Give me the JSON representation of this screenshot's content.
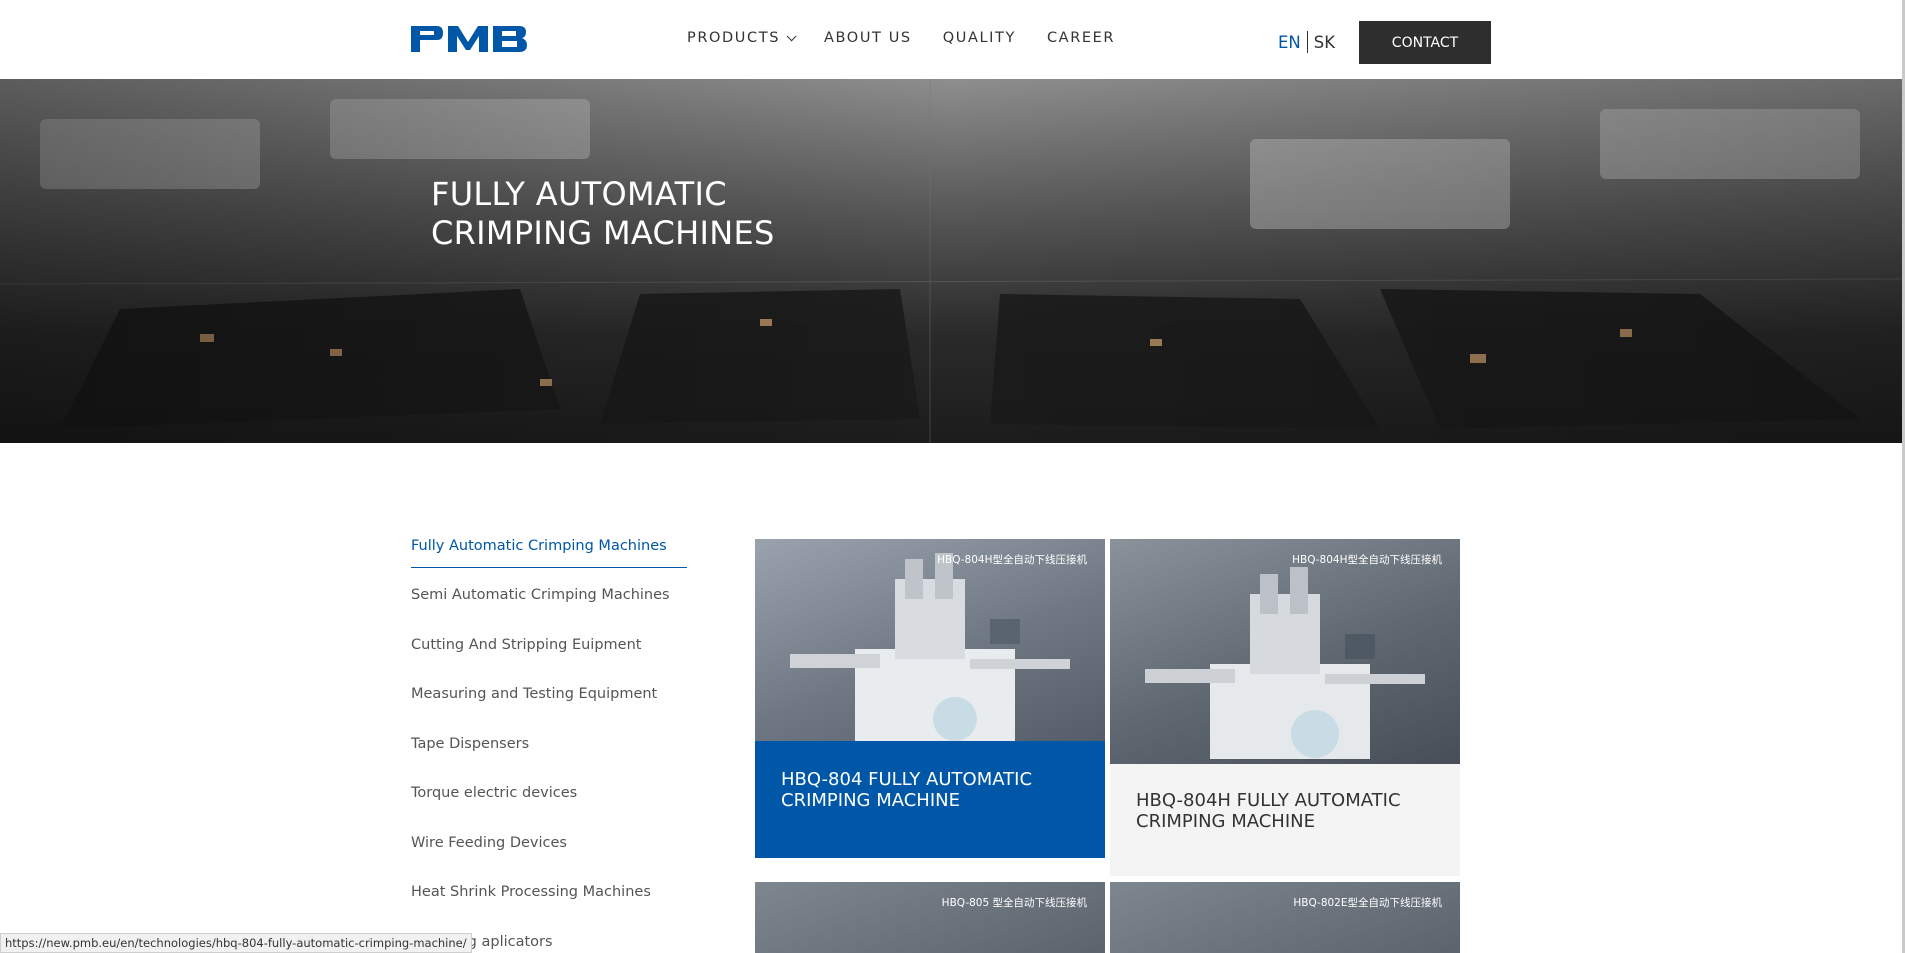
{
  "header": {
    "logo_text": "PMB",
    "nav": [
      {
        "label": "PRODUCTS",
        "has_dropdown": true
      },
      {
        "label": "ABOUT US"
      },
      {
        "label": "QUALITY"
      },
      {
        "label": "CAREER"
      }
    ],
    "lang": {
      "en": "EN",
      "sk": "SK",
      "active": "EN"
    },
    "contact_label": "CONTACT",
    "colors": {
      "brand_blue": "#0057a8",
      "contact_bg": "#2e2e2e"
    }
  },
  "hero": {
    "title": "FULLY AUTOMATIC CRIMPING MACHINES"
  },
  "sidebar": {
    "items": [
      {
        "label": "Fully Automatic Crimping Machines",
        "active": true
      },
      {
        "label": "Semi Automatic Crimping Machines"
      },
      {
        "label": "Cutting And Stripping Euipment"
      },
      {
        "label": "Measuring and Testing Equipment"
      },
      {
        "label": "Tape Dispensers"
      },
      {
        "label": "Torque electric devices"
      },
      {
        "label": "Wire Feeding Devices"
      },
      {
        "label": "Heat Shrink Processing Machines"
      },
      {
        "label": "Crimping aplicators"
      }
    ]
  },
  "products": [
    {
      "image_caption": "HBQ-804H型全自动下线压接机",
      "title": "HBQ-804 FULLY AUTOMATIC CRIMPING MACHINE",
      "hovered": true
    },
    {
      "image_caption": "HBQ-804H型全自动下线压接机",
      "title": "HBQ-804H FULLY AUTOMATIC CRIMPING MACHINE"
    },
    {
      "image_caption": "HBQ-805 型全自动下线压接机",
      "title": ""
    },
    {
      "image_caption": "HBQ-802E型全自动下线压接机",
      "title": ""
    }
  ],
  "status_bar": {
    "url": "https://new.pmb.eu/en/technologies/hbq-804-fully-automatic-crimping-machine/"
  }
}
